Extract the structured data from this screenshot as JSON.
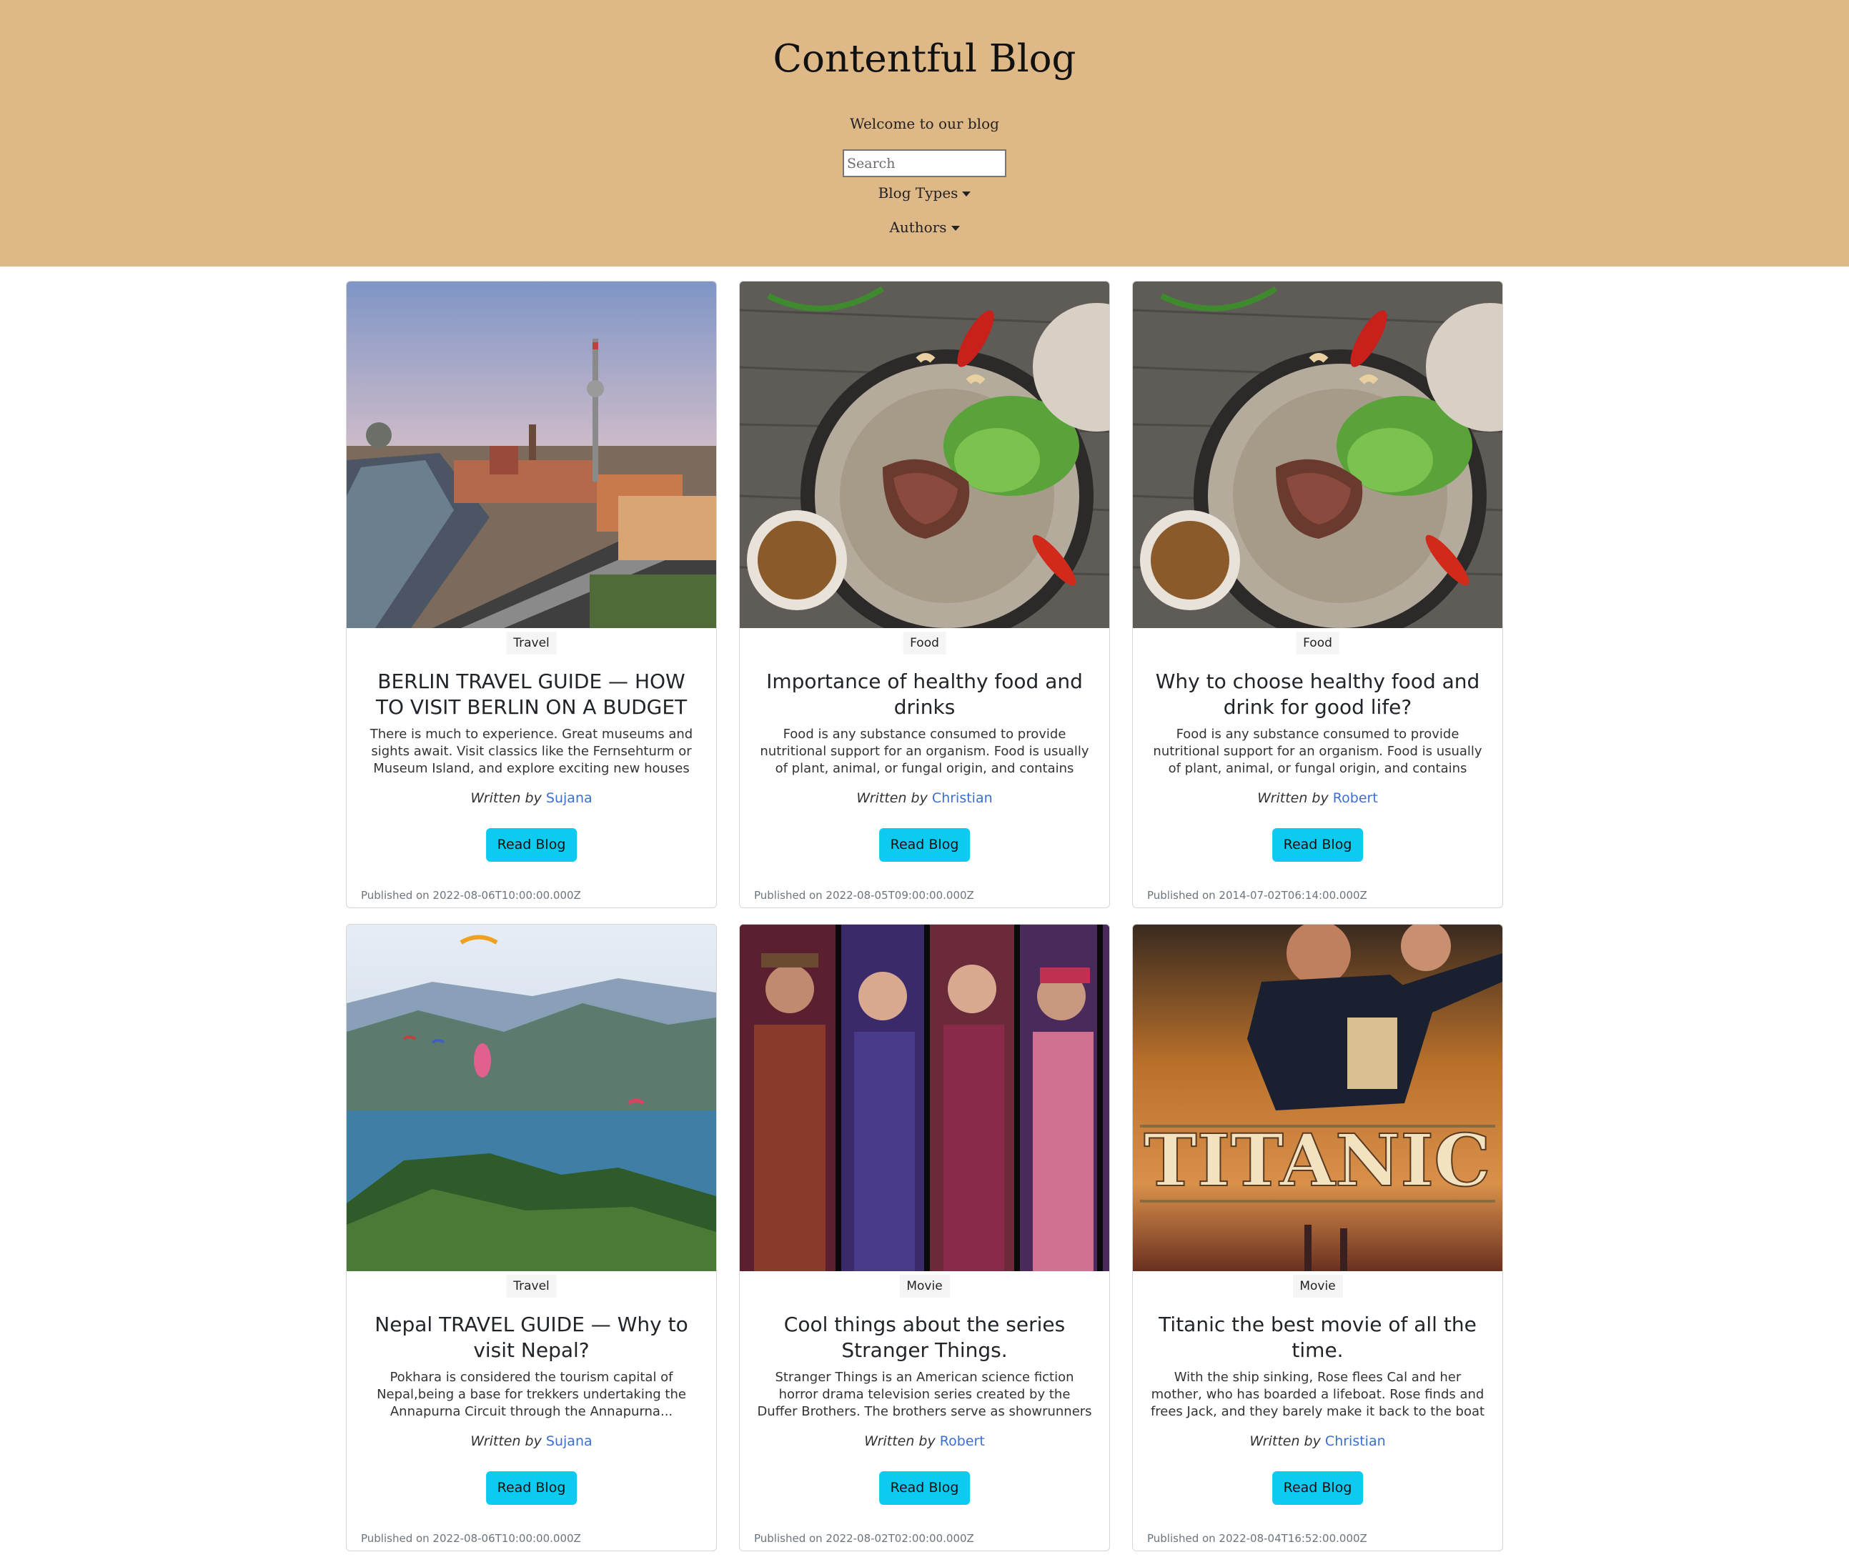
{
  "header": {
    "title": "Contentful Blog",
    "welcome": "Welcome to our blog",
    "search_placeholder": "Search",
    "blog_types_label": "Blog Types",
    "authors_label": "Authors",
    "background_color": "#deb887"
  },
  "cards": [
    {
      "image": "berlin-skyline-image",
      "tag": "Travel",
      "title": "BERLIN TRAVEL GUIDE — HOW TO VISIT BERLIN ON A BUDGET",
      "excerpt": "There is much to experience. Great museums and sights await. Visit classics like the Fernsehturm or Museum Island, and explore exciting new houses lik...",
      "written_by": "Written by",
      "author": "Sujana",
      "button": "Read Blog",
      "published": "Published on 2022-08-06T10:00:00.000Z"
    },
    {
      "image": "healthy-food-plate-image",
      "tag": "Food",
      "title": "Importance of healthy food and drinks",
      "excerpt": "Food is any substance consumed to provide nutritional support for an organism. Food is usually of plant, animal, or fungal origin, and contains essentia...",
      "written_by": "Written by",
      "author": "Christian",
      "button": "Read Blog",
      "published": "Published on 2022-08-05T09:00:00.000Z"
    },
    {
      "image": "healthy-food-plate-image",
      "tag": "Food",
      "title": "Why to choose healthy food and drink for good life?",
      "excerpt": "Food is any substance consumed to provide nutritional support for an organism. Food is usually of plant, animal, or fungal origin, and contains essentia...",
      "written_by": "Written by",
      "author": "Robert",
      "button": "Read Blog",
      "published": "Published on 2014-07-02T06:14:00.000Z"
    },
    {
      "image": "nepal-paragliding-image",
      "tag": "Travel",
      "title": "Nepal TRAVEL GUIDE — Why to visit Nepal?",
      "excerpt": "Pokhara is considered the tourism capital of Nepal,being a base for trekkers undertaking the Annapurna Circuit through the Annapurna...",
      "written_by": "Written by",
      "author": "Sujana",
      "button": "Read Blog",
      "published": "Published on 2022-08-06T10:00:00.000Z"
    },
    {
      "image": "stranger-things-poster-image",
      "tag": "Movie",
      "title": "Cool things about the series Stranger Things.",
      "excerpt": "Stranger Things is an American science fiction horror drama television series created by the Duffer Brothers. The brothers serve as showrunners and are executiv...",
      "written_by": "Written by",
      "author": "Robert",
      "button": "Read Blog",
      "published": "Published on 2022-08-02T02:00:00.000Z"
    },
    {
      "image": "titanic-poster-image",
      "tag": "Movie",
      "title": "Titanic the best movie of all the time.",
      "excerpt": "With the ship sinking, Rose flees Cal and her mother, who has boarded a lifeboat. Rose finds and frees Jack, and they barely make it back to the boat deck.",
      "written_by": "Written by",
      "author": "Christian",
      "button": "Read Blog",
      "published": "Published on 2022-08-04T16:52:00.000Z",
      "poster_text": "TITANIC"
    }
  ],
  "colors": {
    "button": "#0dcaf0",
    "author_link": "#3b6fd6",
    "muted": "#6c757d"
  }
}
